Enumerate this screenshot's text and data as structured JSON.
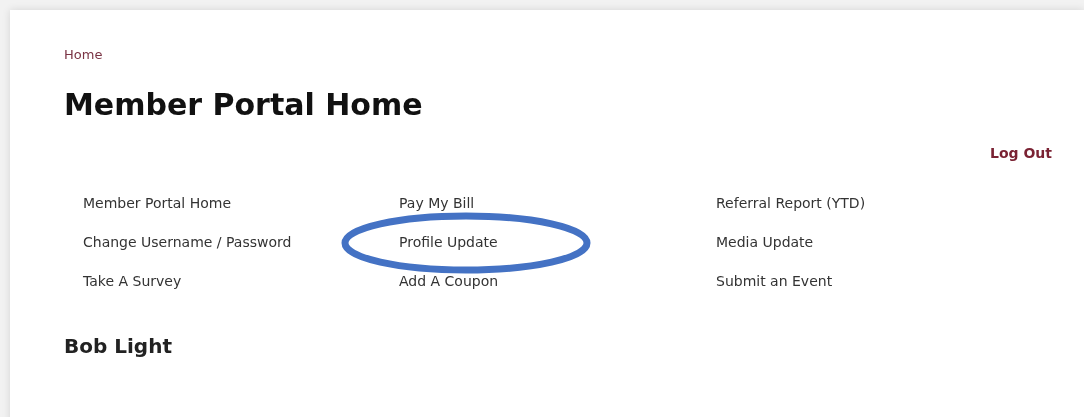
{
  "breadcrumb": "Home",
  "title": "Member Portal Home",
  "logout": "Log Out",
  "links": [
    "Member Portal Home",
    "Pay My Bill",
    "Referral Report (YTD)",
    "Change Username / Password",
    "Profile Update",
    "Media Update",
    "Take A Survey",
    "Add A Coupon",
    "Submit an Event"
  ],
  "member_name": "Bob Light",
  "annotation": {
    "kind": "ellipse"
  }
}
